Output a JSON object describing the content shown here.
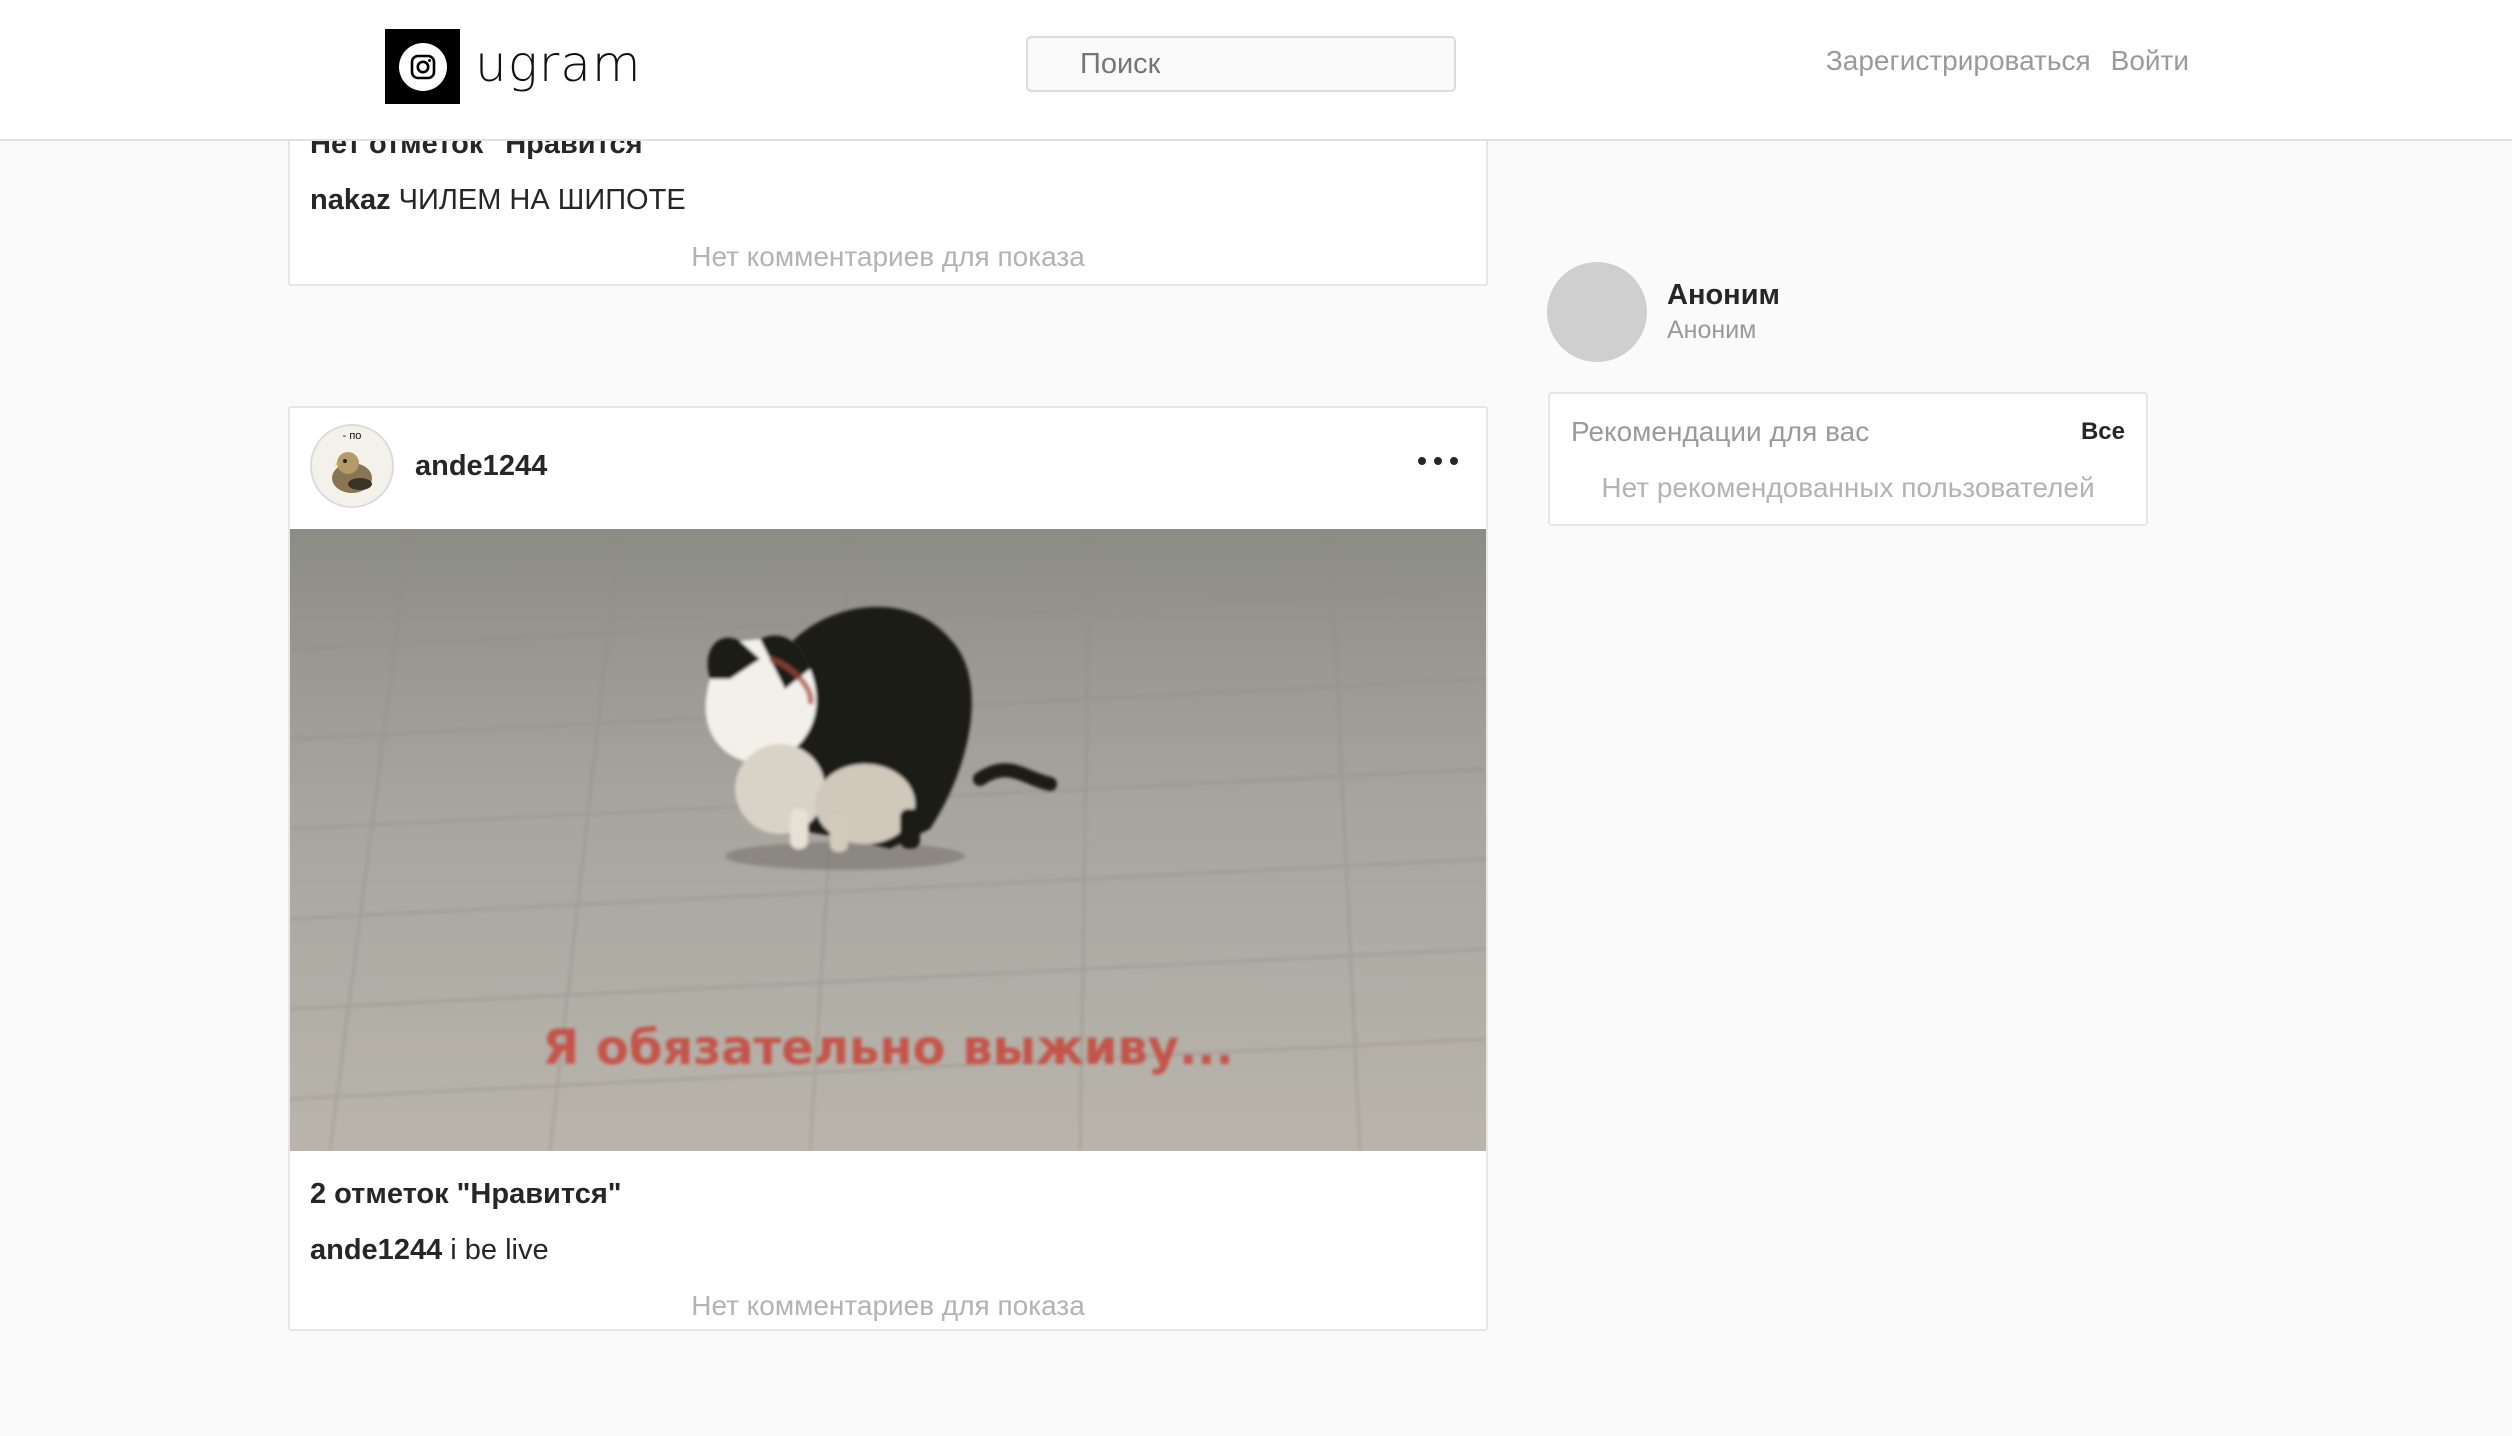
{
  "header": {
    "logo_text": "ugram",
    "search_placeholder": "Поиск",
    "signup_label": "Зарегистрироваться",
    "login_label": "Войти"
  },
  "feed": {
    "posts": [
      {
        "likes_text": "Нет отметок \"Нравится\"",
        "caption_user": "nakaz",
        "caption_text": "ЧИЛЕМ НА ШИПОТЕ",
        "no_comments": "Нет комментариев для показа"
      },
      {
        "username": "ande1244",
        "avatar_overlay_text": "- по",
        "image_text": "Я обязательно выживу...",
        "likes_text": "2 отметок \"Нравится\"",
        "caption_user": "ande1244",
        "caption_text": "i be live",
        "no_comments": "Нет комментариев для показа"
      }
    ]
  },
  "sidebar": {
    "profile": {
      "name": "Аноним",
      "subtitle": "Аноним"
    },
    "recommendations": {
      "title": "Рекомендации для вас",
      "all_label": "Все",
      "empty_text": "Нет рекомендованных пользователей"
    }
  },
  "colors": {
    "background": "#fafafa",
    "card": "#ffffff",
    "border": "#e6e6e6",
    "muted_text": "#9a9a9a",
    "image_caption": "#c8443a"
  }
}
